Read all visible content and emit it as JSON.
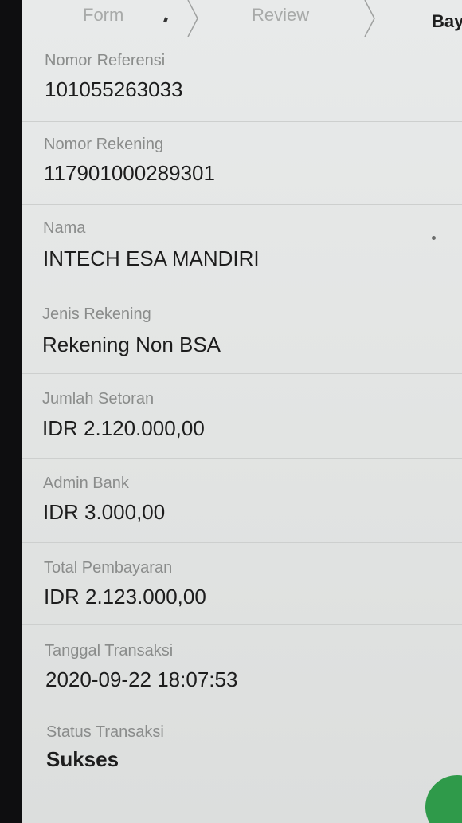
{
  "stepper": {
    "steps": [
      {
        "label": "Form"
      },
      {
        "label": "Review"
      },
      {
        "label": "Bay"
      }
    ]
  },
  "details": [
    {
      "label": "Nomor Referensi",
      "value": "101055263033"
    },
    {
      "label": "Nomor Rekening",
      "value": "117901000289301"
    },
    {
      "label": "Nama",
      "value": "INTECH ESA MANDIRI"
    },
    {
      "label": "Jenis Rekening",
      "value": "Rekening Non BSA"
    },
    {
      "label": "Jumlah Setoran",
      "value": "IDR 2.120.000,00"
    },
    {
      "label": "Admin Bank",
      "value": "IDR 3.000,00"
    },
    {
      "label": "Total Pembayaran",
      "value": "IDR 2.123.000,00"
    },
    {
      "label": "Tanggal Transaksi",
      "value": "2020-09-22 18:07:53"
    },
    {
      "label": "Status Transaksi",
      "value": "Sukses"
    }
  ],
  "colors": {
    "accent": "#2f9a4a",
    "label": "#8a8c8b",
    "value": "#1d1d1d"
  }
}
